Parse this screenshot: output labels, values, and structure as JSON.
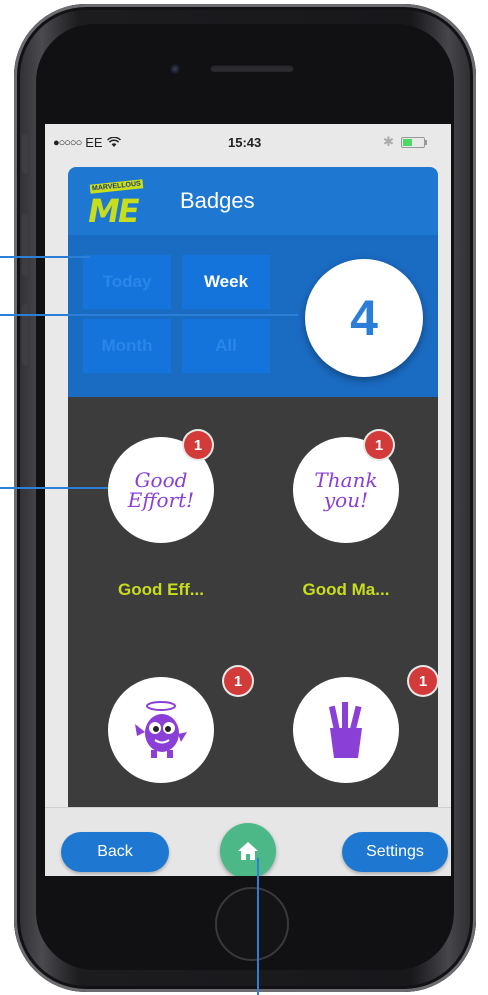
{
  "status_bar": {
    "signal": "●○○○○",
    "carrier": "EE",
    "time": "15:43",
    "bluetooth": "✱"
  },
  "header": {
    "logo_tag": "MARVELLOUS",
    "logo_text": "ME",
    "title": "Badges"
  },
  "filters": {
    "items": [
      {
        "label": "Today",
        "active": false
      },
      {
        "label": "Week",
        "active": true
      },
      {
        "label": "Month",
        "active": false
      },
      {
        "label": "All",
        "active": false
      }
    ],
    "count": "4"
  },
  "badges": [
    {
      "art_text": "Good Effort!",
      "label": "Good Eff...",
      "notification": "1",
      "icon": "good-effort-icon"
    },
    {
      "art_text": "Thank you!",
      "label": "Good Ma...",
      "notification": "1",
      "icon": "thank-you-icon"
    },
    {
      "art_text": "",
      "label": "",
      "notification": "1",
      "icon": "monster-icon"
    },
    {
      "art_text": "",
      "label": "",
      "notification": "1",
      "icon": "pencil-pot-icon"
    }
  ],
  "bottom_bar": {
    "back_label": "Back",
    "settings_label": "Settings",
    "home_icon": "home-icon"
  },
  "colors": {
    "accent_blue": "#1e78d2",
    "badge_label": "#c8de1c",
    "notification": "#d33a3a",
    "home_button": "#4cb888"
  }
}
